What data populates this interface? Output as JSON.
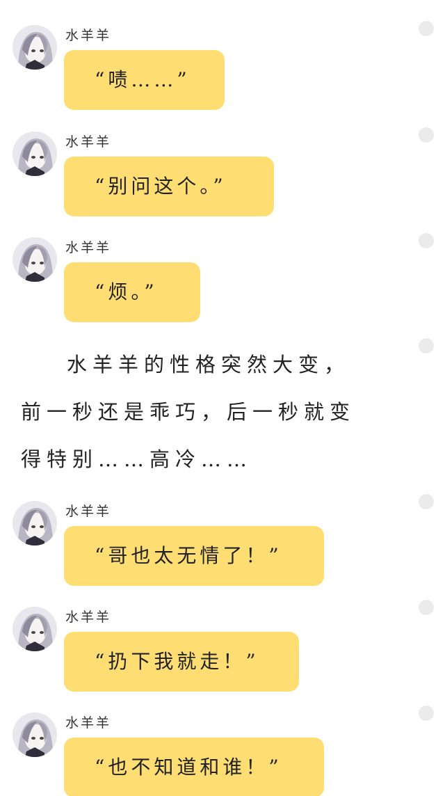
{
  "messages": [
    {
      "sender": "水羊羊",
      "text": "“啧……”"
    },
    {
      "sender": "水羊羊",
      "text": "“别问这个。”"
    },
    {
      "sender": "水羊羊",
      "text": "“烦。”"
    },
    {
      "sender": "水羊羊",
      "text": "“哥也太无情了！”"
    },
    {
      "sender": "水羊羊",
      "text": "“扔下我就走！”"
    },
    {
      "sender": "水羊羊",
      "text": "“也不知道和谁！”"
    }
  ],
  "narration": {
    "text": "水羊羊的性格突然大变，前一秒还是乖巧，后一秒就变得特别……高冷……"
  },
  "colors": {
    "bubble": "#fedd73",
    "dot": "#ebebeb"
  },
  "icons": {
    "avatar": "anime-girl-avatar",
    "dot": "grey-circle-dot"
  }
}
